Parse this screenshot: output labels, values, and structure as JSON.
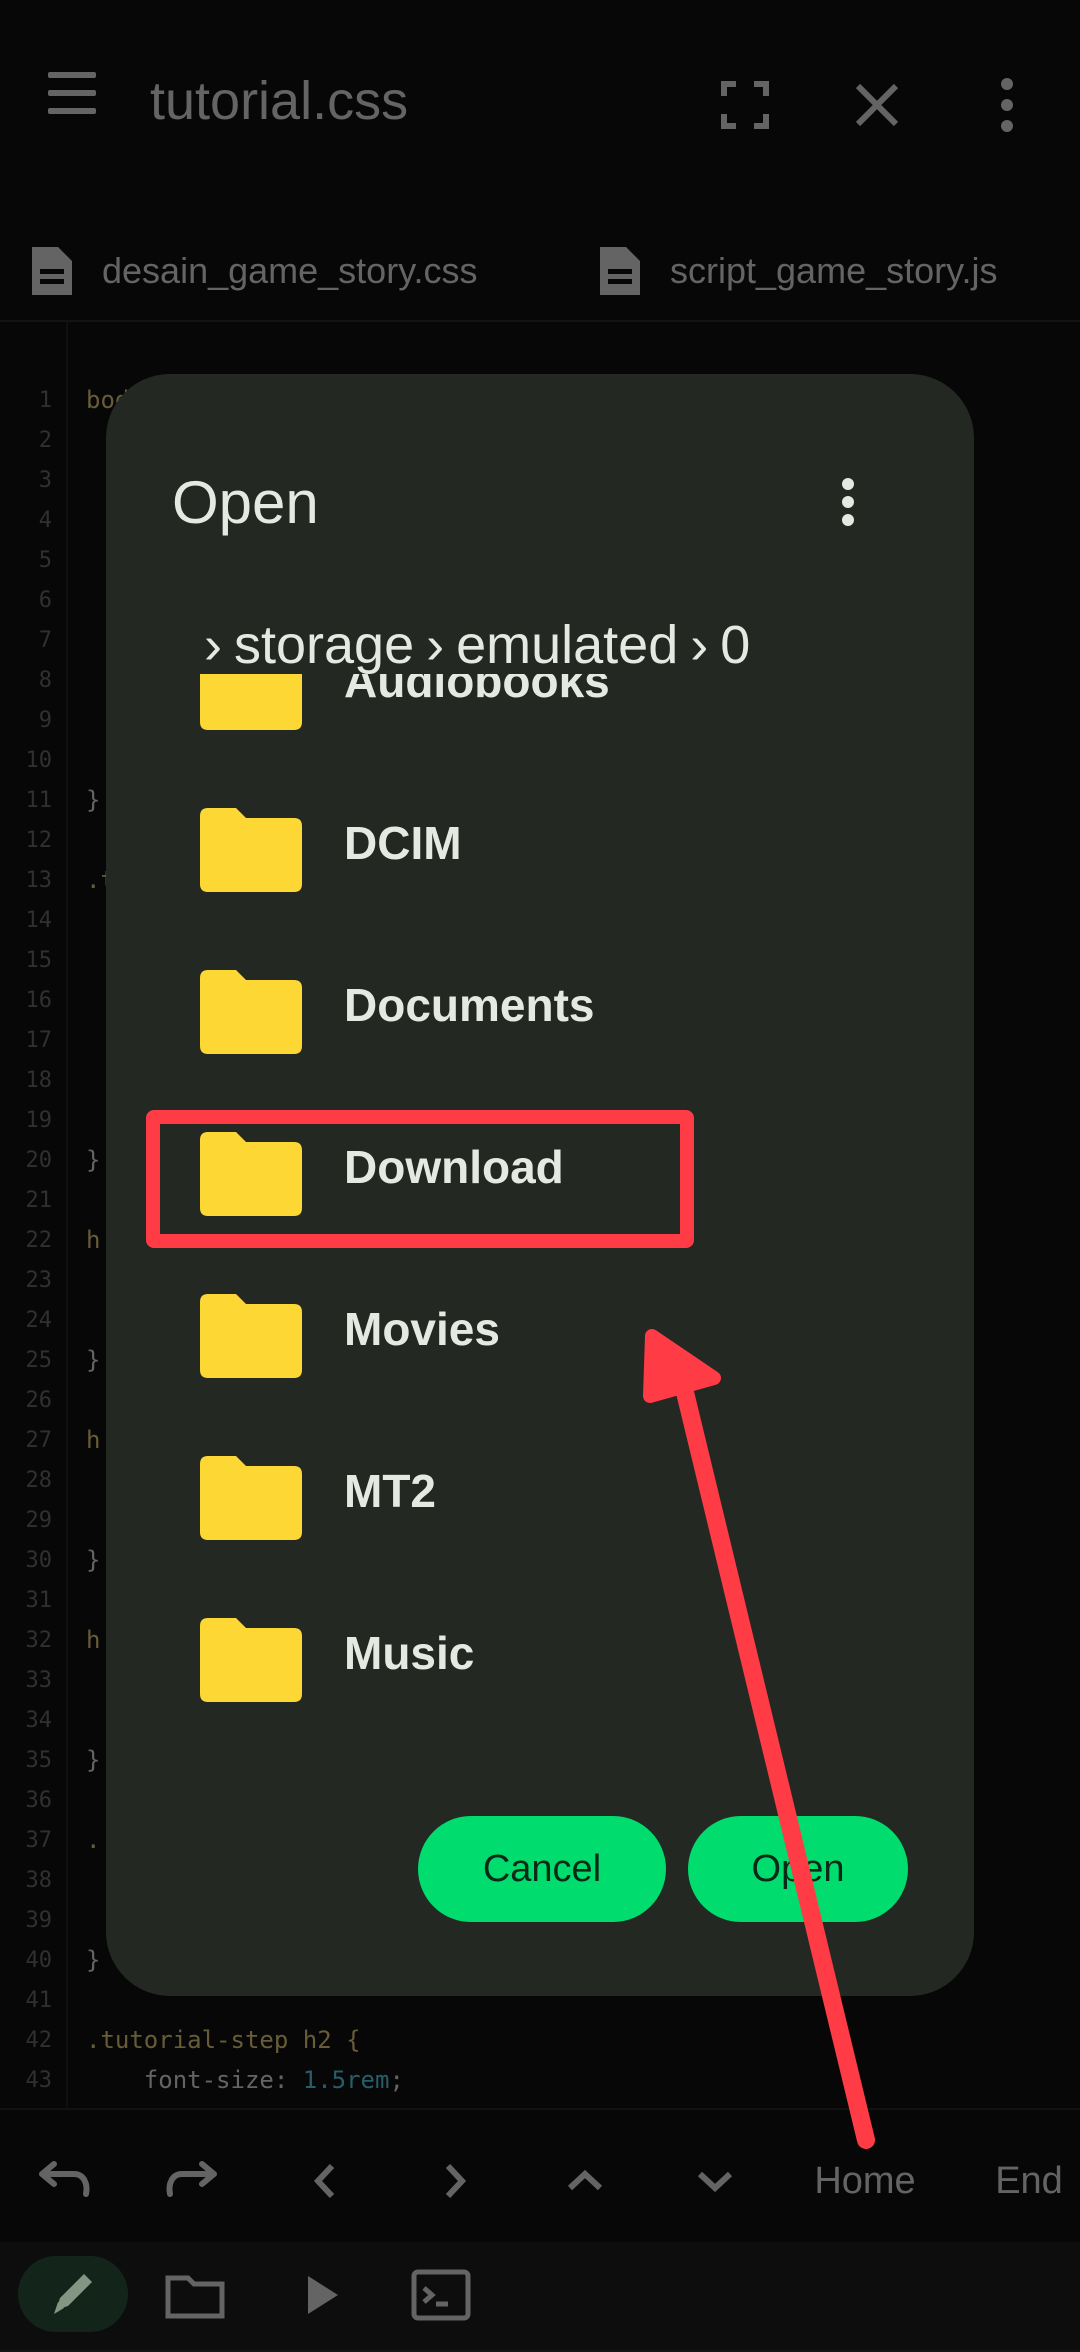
{
  "header": {
    "title": "tutorial.css",
    "icons": [
      "menu-icon",
      "fullscreen-icon",
      "close-icon",
      "more-vert-icon"
    ]
  },
  "tabs": [
    {
      "label": "desain_game_story.css",
      "icon": "document-icon"
    },
    {
      "label": "script_game_story.js",
      "icon": "document-icon"
    }
  ],
  "editor": {
    "line_numbers": [
      "1",
      "2",
      "3",
      "4",
      "5",
      "6",
      "7",
      "8",
      "9",
      "10",
      "11",
      "12",
      "13",
      "14",
      "15",
      "16",
      "17",
      "18",
      "19",
      "20",
      "21",
      "22",
      "23",
      "24",
      "25",
      "26",
      "27",
      "28",
      "29",
      "30",
      "31",
      "32",
      "33",
      "34",
      "35",
      "36",
      "37",
      "38",
      "39",
      "40",
      "41",
      "42",
      "43"
    ],
    "visible_fragments": {
      "l1": "bod",
      "l11": "}",
      "l13": ".t",
      "l20": "}",
      "l22": "h",
      "l25": "}",
      "l27": "h",
      "l30": "}",
      "l32": "h",
      "l35": "}",
      "l37": ".",
      "l40": "}",
      "l42": ".tutorial-step h2 {",
      "l43_prop": "    font-size: ",
      "l43_val": "1.5rem",
      "l43_end": ";"
    }
  },
  "dialog": {
    "title": "Open",
    "breadcrumb": [
      "storage",
      "emulated",
      "0"
    ],
    "folders": [
      "Audiobooks",
      "DCIM",
      "Documents",
      "Download",
      "Movies",
      "MT2",
      "Music"
    ],
    "cancel_label": "Cancel",
    "open_label": "Open"
  },
  "keyboard_bar": {
    "home_label": "Home",
    "end_label": "End"
  },
  "colors": {
    "accent": "#00dc6e",
    "folder": "#fdd835",
    "dialog_bg": "#232823",
    "annotation": "#ff3b45"
  }
}
